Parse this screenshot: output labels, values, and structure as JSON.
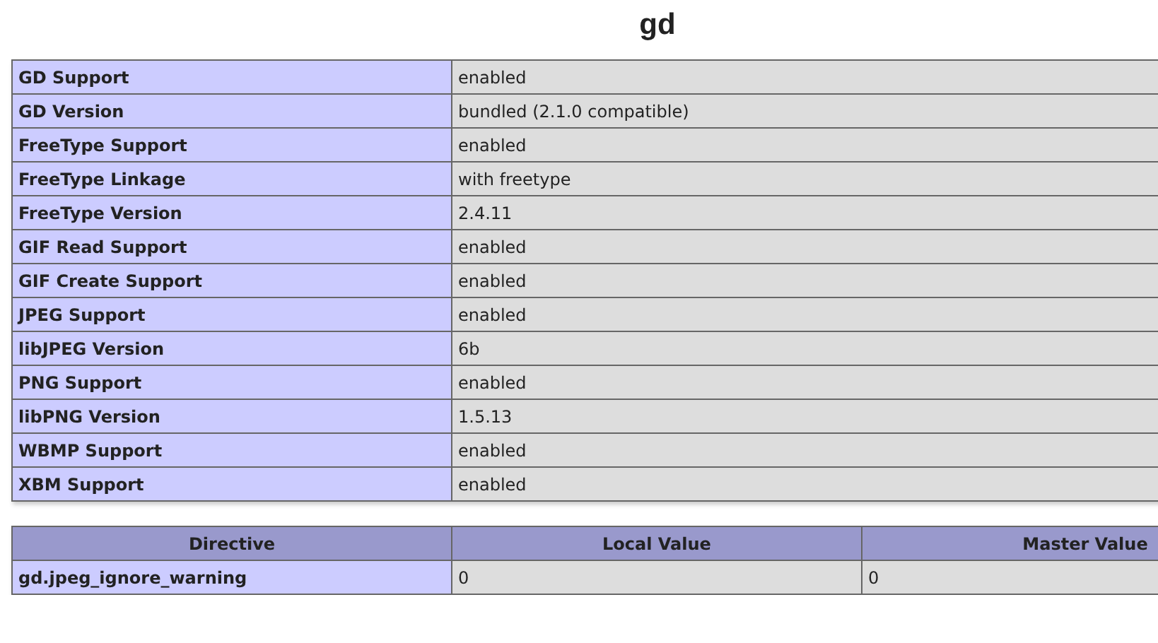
{
  "title": "gd",
  "info_table": [
    {
      "label": "GD Support",
      "value": "enabled"
    },
    {
      "label": "GD Version",
      "value": "bundled (2.1.0 compatible)"
    },
    {
      "label": "FreeType Support",
      "value": "enabled"
    },
    {
      "label": "FreeType Linkage",
      "value": "with freetype"
    },
    {
      "label": "FreeType Version",
      "value": "2.4.11"
    },
    {
      "label": "GIF Read Support",
      "value": "enabled"
    },
    {
      "label": "GIF Create Support",
      "value": "enabled"
    },
    {
      "label": "JPEG Support",
      "value": "enabled"
    },
    {
      "label": "libJPEG Version",
      "value": "6b"
    },
    {
      "label": "PNG Support",
      "value": "enabled"
    },
    {
      "label": "libPNG Version",
      "value": "1.5.13"
    },
    {
      "label": "WBMP Support",
      "value": "enabled"
    },
    {
      "label": "XBM Support",
      "value": "enabled"
    }
  ],
  "directive_table": {
    "columns": [
      "Directive",
      "Local Value",
      "Master Value"
    ],
    "rows": [
      {
        "directive": "gd.jpeg_ignore_warning",
        "local_value": "0",
        "master_value": "0"
      }
    ]
  }
}
